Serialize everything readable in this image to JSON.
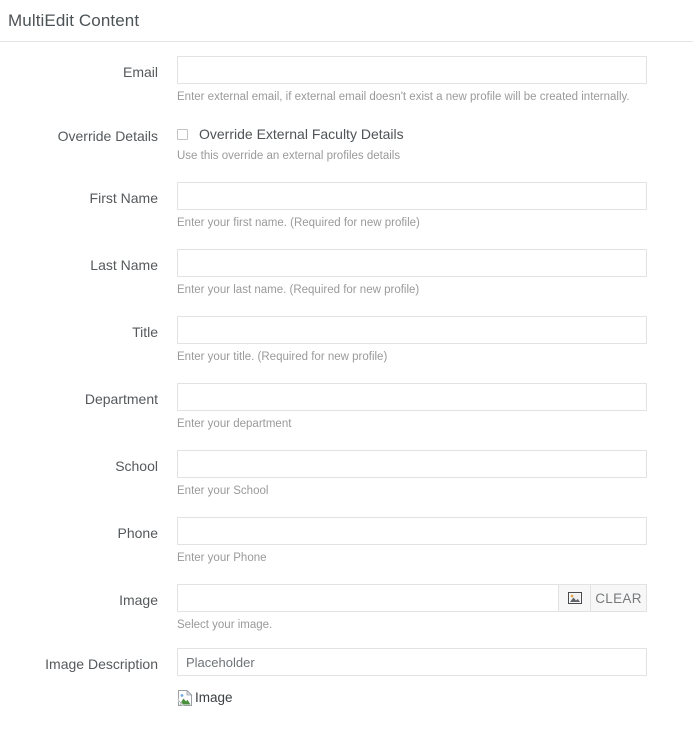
{
  "header": {
    "title": "MultiEdit Content"
  },
  "form": {
    "rows": [
      {
        "label": "Email",
        "type": "text",
        "value": "",
        "placeholder": "",
        "help": "Enter external email, if external email doesn't exist a new profile will be created internally."
      },
      {
        "label": "Override Details",
        "type": "checkbox",
        "checkbox_label": "Override External Faculty Details",
        "checked": false,
        "help": "Use this override an external profiles details"
      },
      {
        "label": "First Name",
        "type": "text",
        "value": "",
        "placeholder": "",
        "help": "Enter your first name. (Required for new profile)"
      },
      {
        "label": "Last Name",
        "type": "text",
        "value": "",
        "placeholder": "",
        "help": "Enter your last name. (Required for new profile)"
      },
      {
        "label": "Title",
        "type": "text",
        "value": "",
        "placeholder": "",
        "help": "Enter your title. (Required for new profile)"
      },
      {
        "label": "Department",
        "type": "text",
        "value": "",
        "placeholder": "",
        "help": "Enter your department"
      },
      {
        "label": "School",
        "type": "text",
        "value": "",
        "placeholder": "",
        "help": "Enter your School"
      },
      {
        "label": "Phone",
        "type": "text",
        "value": "",
        "placeholder": "",
        "help": "Enter your Phone"
      },
      {
        "label": "Image",
        "type": "image-picker",
        "value": "",
        "placeholder": "",
        "browse_icon": "picture-icon",
        "clear_label": "CLEAR",
        "help": "Select your image."
      },
      {
        "label": "Image Description",
        "type": "text",
        "value": "",
        "placeholder": "Placeholder",
        "help": ""
      }
    ],
    "broken_image": {
      "alt_text": "Image",
      "icon": "broken-image-icon"
    }
  },
  "colors": {
    "border": "#e2e2e2",
    "label": "#55595c",
    "help": "#9a9a9a",
    "title": "#4c5356",
    "button_bg": "#f7f7f7"
  }
}
